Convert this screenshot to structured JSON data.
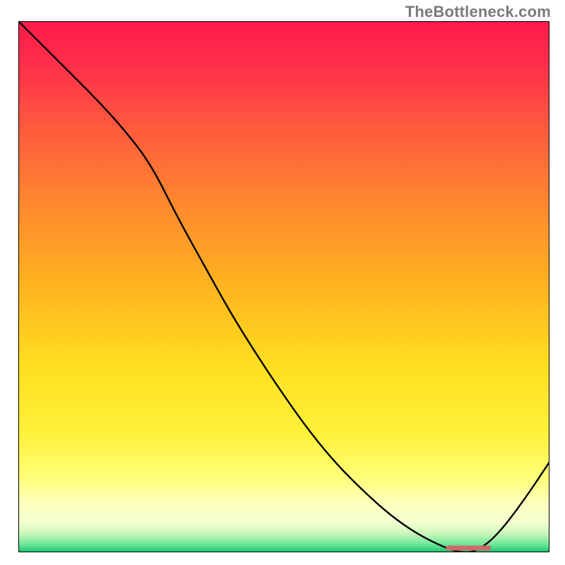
{
  "watermark": "TheBottleneck.com",
  "chart_data": {
    "type": "line",
    "title": "",
    "xlabel": "",
    "ylabel": "",
    "xlim": [
      0,
      100
    ],
    "ylim": [
      0,
      100
    ],
    "grid": false,
    "legend": false,
    "series": [
      {
        "name": "curve",
        "x": [
          0,
          5,
          10,
          15,
          20,
          25,
          30,
          35,
          40,
          45,
          50,
          55,
          60,
          65,
          70,
          75,
          80,
          83,
          86,
          90,
          95,
          100
        ],
        "y": [
          100,
          95,
          90,
          85,
          79.5,
          73,
          63,
          54,
          45,
          37,
          29.5,
          22.5,
          16.5,
          11.5,
          7,
          3.5,
          1,
          0,
          0,
          3,
          9.5,
          17
        ]
      }
    ],
    "marker": {
      "name": "highlight-segment",
      "x_start": 80.5,
      "x_end": 89,
      "y": 0.8,
      "color": "#cf6a6a"
    },
    "gradient_stops": [
      {
        "offset": 0.0,
        "color": "#ff1a4b"
      },
      {
        "offset": 0.08,
        "color": "#ff2e4a"
      },
      {
        "offset": 0.2,
        "color": "#ff5a3d"
      },
      {
        "offset": 0.35,
        "color": "#ff8a2e"
      },
      {
        "offset": 0.5,
        "color": "#ffb41f"
      },
      {
        "offset": 0.65,
        "color": "#ffdf20"
      },
      {
        "offset": 0.78,
        "color": "#fff23a"
      },
      {
        "offset": 0.86,
        "color": "#ffff7a"
      },
      {
        "offset": 0.91,
        "color": "#ffffc0"
      },
      {
        "offset": 0.945,
        "color": "#f3ffd0"
      },
      {
        "offset": 0.965,
        "color": "#c9f7b9"
      },
      {
        "offset": 0.985,
        "color": "#6fe69a"
      },
      {
        "offset": 1.0,
        "color": "#18c56e"
      }
    ]
  }
}
